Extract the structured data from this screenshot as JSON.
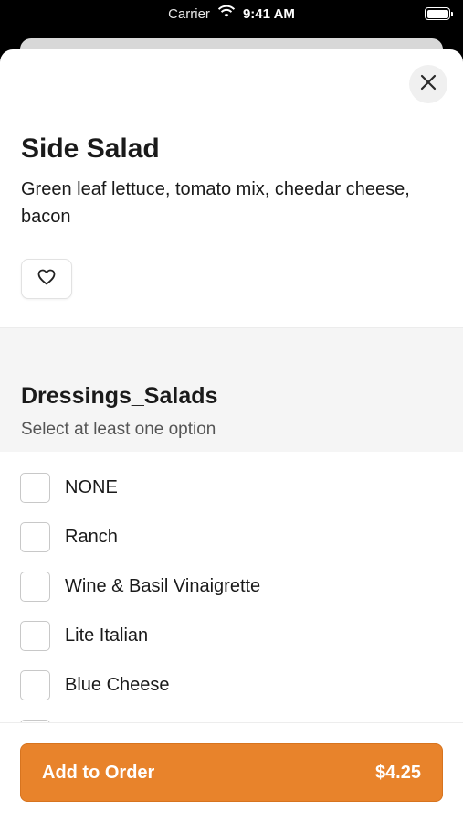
{
  "status_bar": {
    "carrier": "Carrier",
    "time": "9:41 AM"
  },
  "item": {
    "title": "Side Salad",
    "description": "Green leaf lettuce, tomato mix, cheedar cheese, bacon"
  },
  "modifier_group": {
    "title": "Dressings_Salads",
    "subtitle": "Select at least one option",
    "options": [
      {
        "label": "NONE",
        "checked": false
      },
      {
        "label": "Ranch",
        "checked": false
      },
      {
        "label": "Wine & Basil Vinaigrette",
        "checked": false
      },
      {
        "label": "Lite Italian",
        "checked": false
      },
      {
        "label": "Blue Cheese",
        "checked": false
      }
    ]
  },
  "footer": {
    "add_label": "Add to Order",
    "price": "$4.25"
  },
  "colors": {
    "accent": "#e8832b",
    "background": "#ffffff",
    "section_bg": "#f5f5f5"
  },
  "icons": {
    "close": "close-icon",
    "favorite": "heart-icon",
    "wifi": "wifi-icon",
    "battery": "battery-icon"
  }
}
